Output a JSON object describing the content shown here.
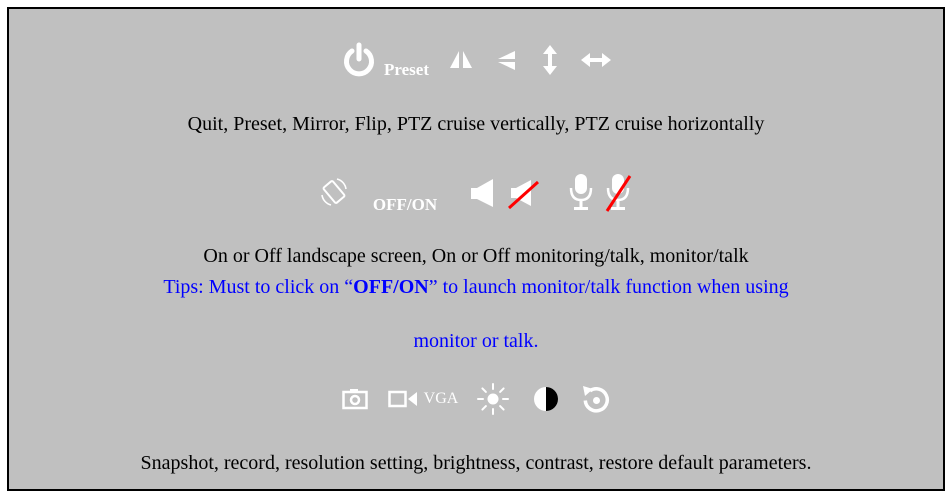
{
  "colors": {
    "panel_bg": "#c0c0c0",
    "icon_white": "#ffffff",
    "strike_red": "#ff0000",
    "tips_blue": "#0000ff",
    "text_black": "#000000"
  },
  "row1": {
    "icons": [
      "power-icon",
      "mirror-icon",
      "flip-icon",
      "vertical-arrows-icon",
      "horizontal-arrows-icon"
    ],
    "preset_label": "Preset",
    "caption": "Quit, Preset, Mirror, Flip, PTZ cruise vertically, PTZ cruise horizontally"
  },
  "row2": {
    "icons": [
      "screen-rotate-icon",
      "speaker-icon",
      "speaker-muted-icon",
      "microphone-icon",
      "microphone-muted-icon"
    ],
    "offon_label": "OFF/ON",
    "caption": "On or Off landscape screen, On or Off monitoring/talk, monitor/talk",
    "tips_prefix": "Tips: Must to click on “",
    "tips_strong": "OFF/ON",
    "tips_suffix": "” to launch monitor/talk function when using",
    "tips_line2": "monitor or talk."
  },
  "row3": {
    "icons": [
      "camera-icon",
      "video-record-icon",
      "sun-icon",
      "contrast-icon",
      "restore-icon"
    ],
    "vga_label": "VGA",
    "caption": "Snapshot, record, resolution setting, brightness, contrast, restore default parameters."
  }
}
